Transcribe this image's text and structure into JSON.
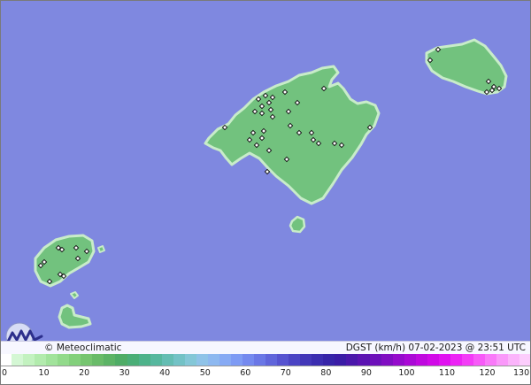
{
  "map": {
    "sea_color": "#7f88e0",
    "land_color": "#72c27e",
    "coast_color": "#c8ecc9",
    "station_marker": "diamond-icon",
    "islands": [
      "mallorca",
      "menorca",
      "ibiza",
      "formentera",
      "cabrera"
    ]
  },
  "footer": {
    "credit": "© Meteoclimatic",
    "title": "DGST (km/h)  07-02-2023 @ 23:51 UTC"
  },
  "legend": {
    "ticks": [
      "0",
      "10",
      "20",
      "30",
      "40",
      "50",
      "60",
      "70",
      "80",
      "90",
      "100",
      "110",
      "120",
      "130"
    ],
    "colors": [
      "#ffffff",
      "#d4f7d4",
      "#c3f2c0",
      "#b2ebad",
      "#a1e39b",
      "#92da8b",
      "#83d07c",
      "#76c570",
      "#69bb69",
      "#5cb366",
      "#4fac66",
      "#4aae77",
      "#4db28a",
      "#56b79e",
      "#64bdb3",
      "#73c2c6",
      "#84c7d7",
      "#8fc3e8",
      "#8db8f0",
      "#87aaf4",
      "#7e9bf4",
      "#7489ef",
      "#6a77e6",
      "#6065db",
      "#5653d0",
      "#4b44c4",
      "#4337b8",
      "#3b2db0",
      "#3624a8",
      "#3a1ca6",
      "#4a17ab",
      "#5b13b2",
      "#6d10ba",
      "#800dc2",
      "#950bcc",
      "#aa09d6",
      "#bf08df",
      "#d109e8",
      "#e012f0",
      "#ec23f5",
      "#f33cf7",
      "#f75af8",
      "#f97af9",
      "#fa98fa",
      "#fbb4fb",
      "#fccdfc"
    ]
  }
}
